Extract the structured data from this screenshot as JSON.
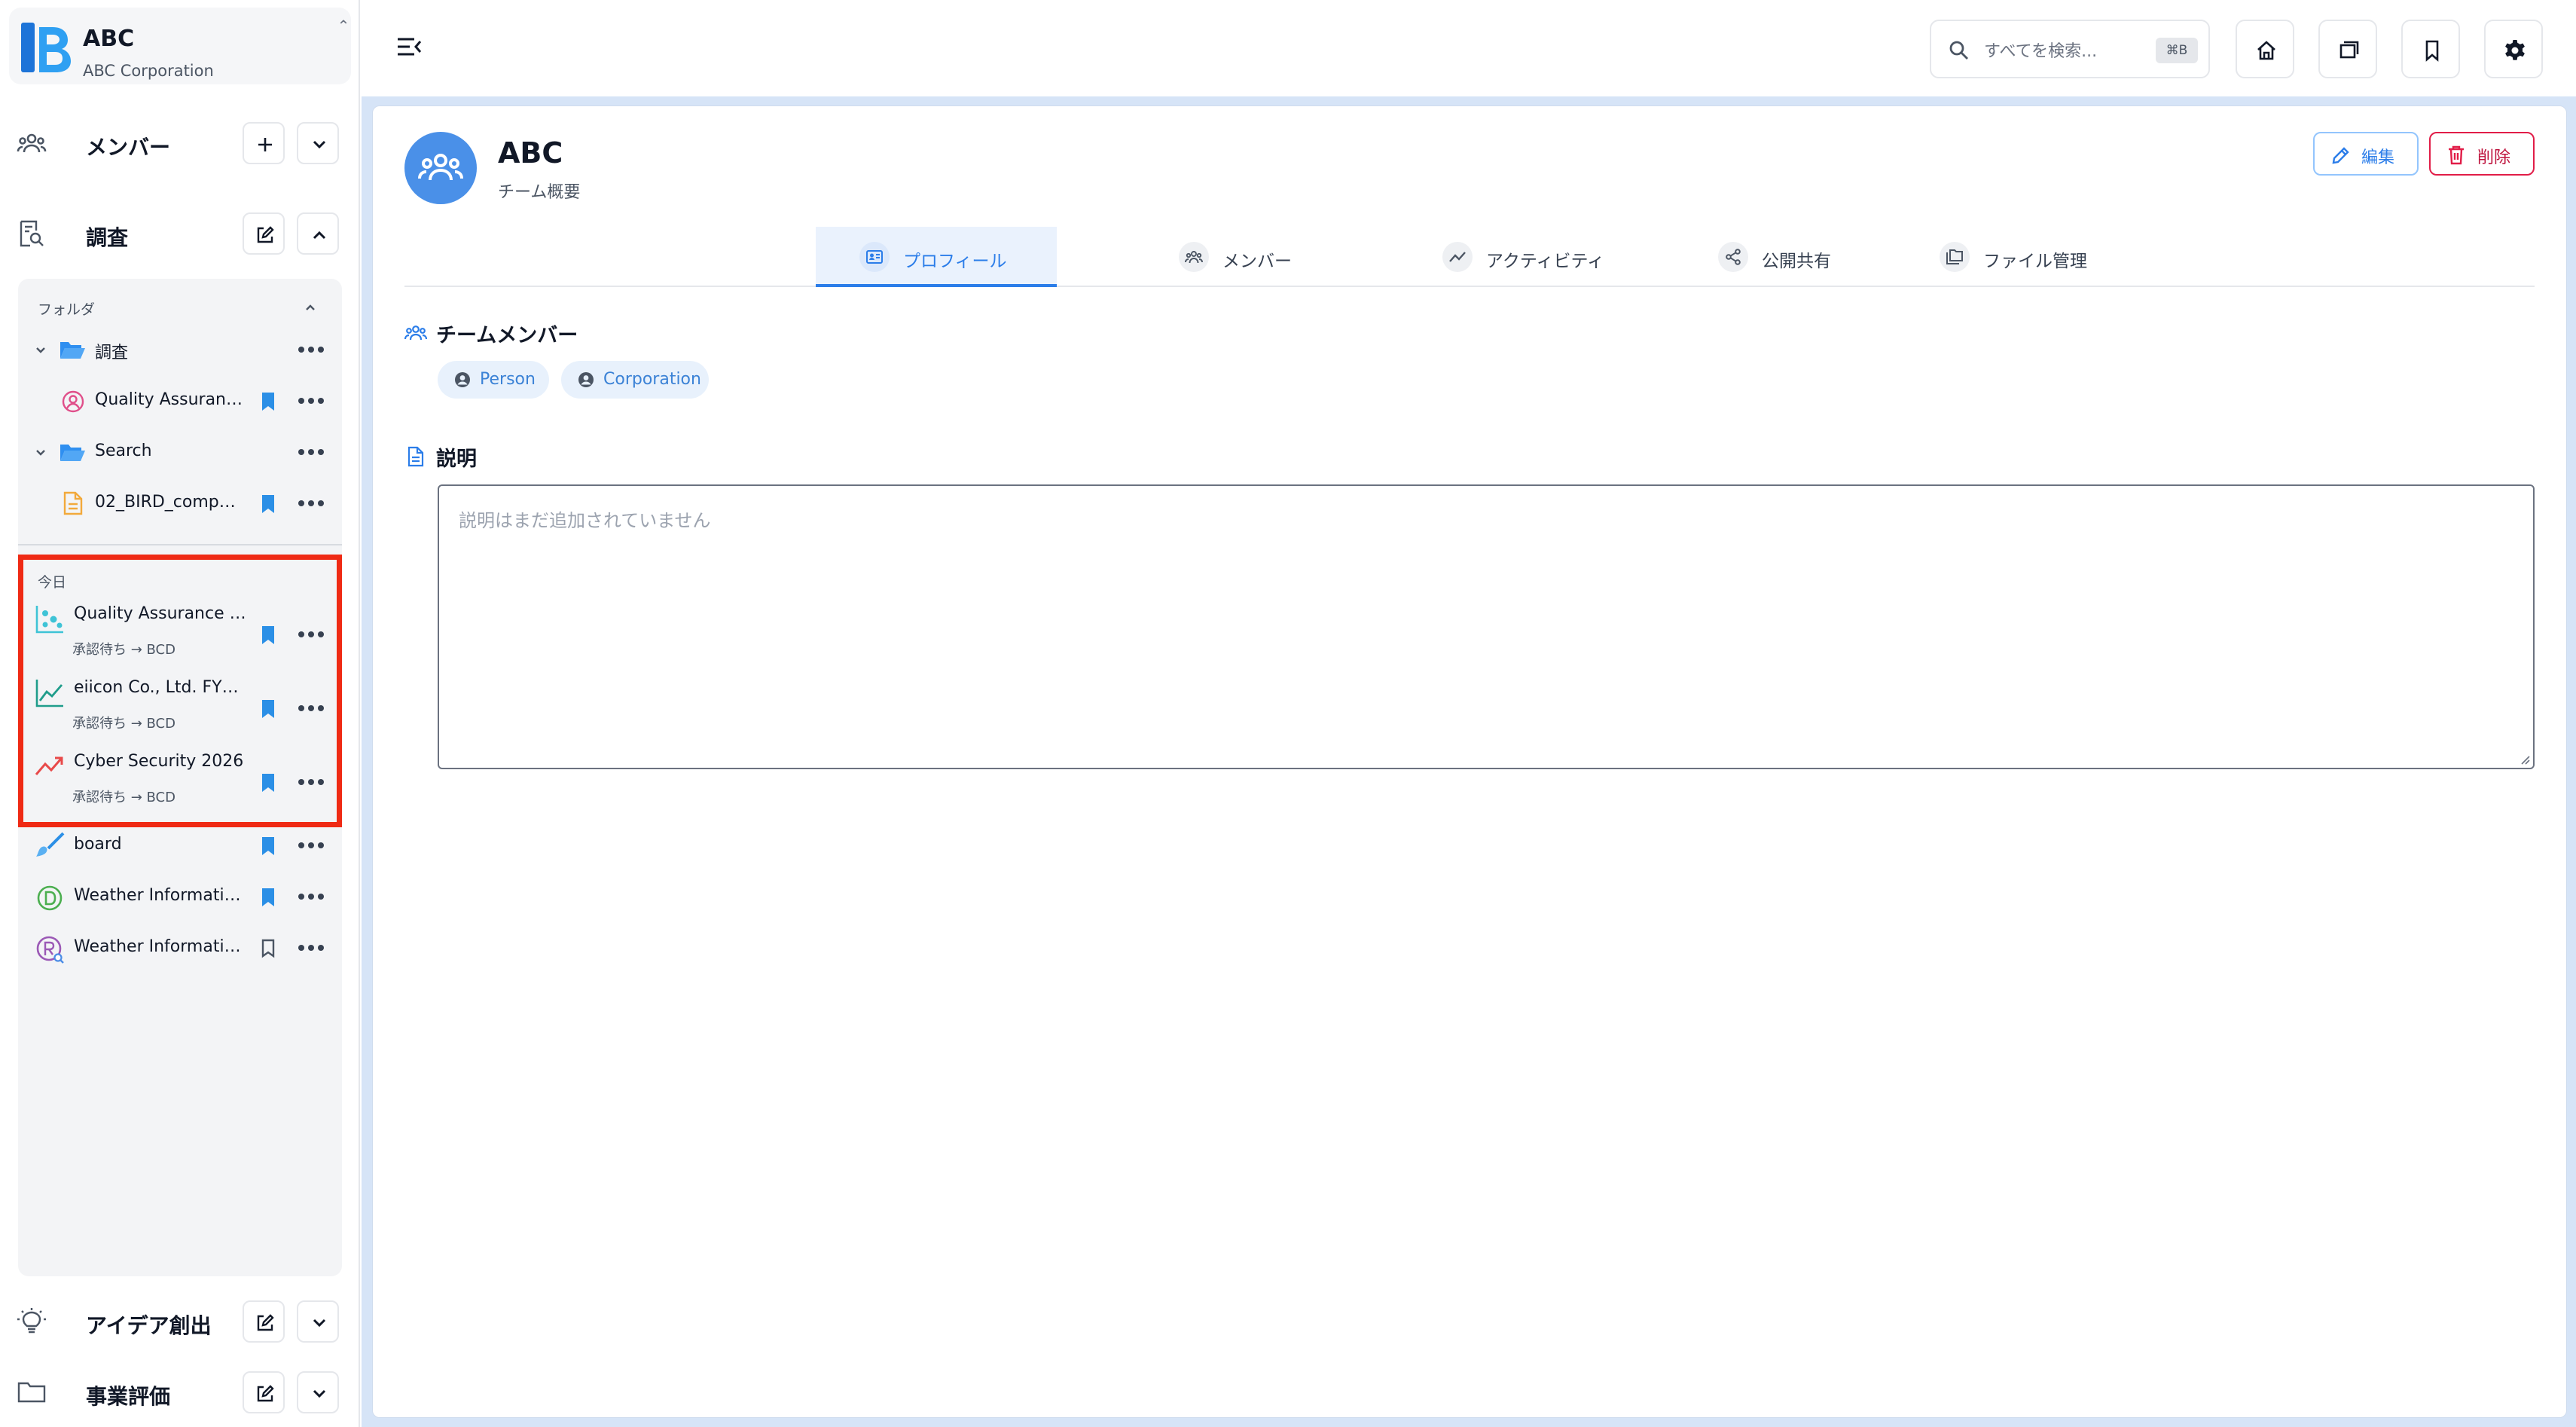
{
  "brand": {
    "title": "ABC",
    "subtitle": "ABC Corporation"
  },
  "sidebar": {
    "sections": {
      "members": {
        "label": "メンバー"
      },
      "research": {
        "label": "調査"
      },
      "ideation": {
        "label": "アイデア創出"
      },
      "evaluation": {
        "label": "事業評価"
      }
    },
    "folders_label": "フォルダ",
    "tree": [
      {
        "label": "調査",
        "type": "folder",
        "expanded": true
      },
      {
        "label": "Quality Assuranc…",
        "type": "persona-doc",
        "bookmarked": true
      },
      {
        "label": "Search",
        "type": "folder",
        "expanded": true
      },
      {
        "label": "02_BIRD_compa…",
        "type": "document",
        "bookmarked": true
      }
    ],
    "today_label": "今日",
    "today_items": [
      {
        "title": "Quality Assurance …",
        "status": "承認待ち → BCD",
        "icon": "scatter-chart-icon",
        "bookmarked": true
      },
      {
        "title": "eiicon Co., Ltd. FY2…",
        "status": "承認待ち → BCD",
        "icon": "line-chart-icon",
        "bookmarked": true
      },
      {
        "title": "Cyber Security 2026",
        "status": "承認待ち → BCD",
        "icon": "trend-up-icon",
        "bookmarked": true
      }
    ],
    "other_items": [
      {
        "title": "board",
        "icon": "brush-icon",
        "bookmarked": true
      },
      {
        "title": "Weather Informatio…",
        "icon": "d-circle-icon",
        "bookmarked": true
      },
      {
        "title": "Weather Informatio…",
        "icon": "r-search-icon",
        "bookmarked": false
      }
    ]
  },
  "topbar": {
    "search": {
      "placeholder": "すべてを検索...",
      "shortcut": "⌘B"
    }
  },
  "team": {
    "name": "ABC",
    "subtitle": "チーム概要"
  },
  "actions": {
    "edit_label": "編集",
    "delete_label": "削除"
  },
  "tabs": [
    {
      "label": "プロフィール",
      "icon": "profile-card-icon",
      "active": true
    },
    {
      "label": "メンバー",
      "icon": "group-icon",
      "active": false
    },
    {
      "label": "アクティビティ",
      "icon": "activity-icon",
      "active": false
    },
    {
      "label": "公開共有",
      "icon": "share-icon",
      "active": false
    },
    {
      "label": "ファイル管理",
      "icon": "files-icon",
      "active": false
    }
  ],
  "members_section": {
    "title": "チームメンバー",
    "chips": [
      {
        "label": "Person"
      },
      {
        "label": "Corporation"
      }
    ]
  },
  "description_section": {
    "title": "説明",
    "placeholder": "説明はまだ追加されていません"
  },
  "colors": {
    "accent": "#2b7de9",
    "danger": "#e11d48",
    "highlight": "#ef2a14",
    "main_bg": "#d6e4f7"
  }
}
